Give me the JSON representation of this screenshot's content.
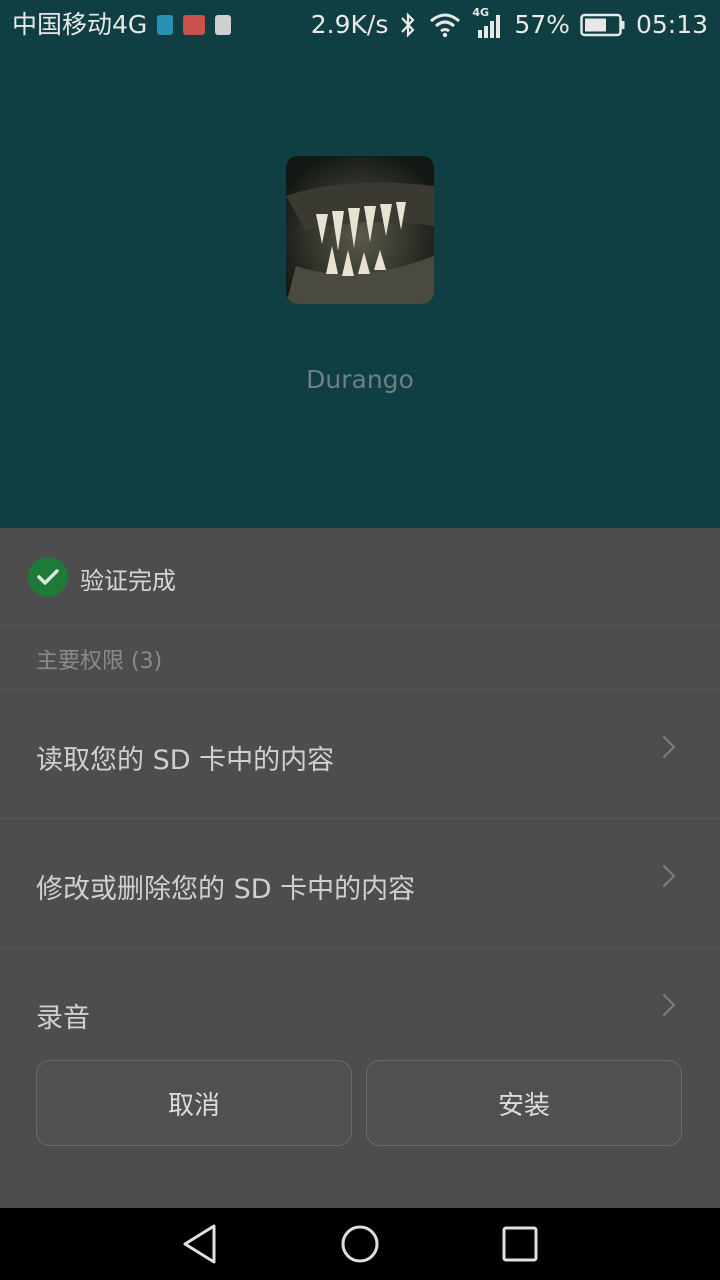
{
  "status_bar": {
    "carrier": "中国移动4G",
    "net_speed": "2.9K/s",
    "network_type": "4G",
    "battery": "57%",
    "time": "05:13"
  },
  "app": {
    "name": "Durango"
  },
  "verification": {
    "text": "验证完成"
  },
  "permissions": {
    "header": "主要权限 (3)",
    "items": [
      {
        "label": "读取您的 SD 卡中的内容"
      },
      {
        "label": "修改或删除您的 SD 卡中的内容"
      },
      {
        "label": "录音"
      }
    ]
  },
  "buttons": {
    "cancel": "取消",
    "install": "安装"
  },
  "colors": {
    "header_bg": "#0f3f42",
    "sheet_bg": "#4d4d4d",
    "check_green": "#1f7a3a"
  }
}
